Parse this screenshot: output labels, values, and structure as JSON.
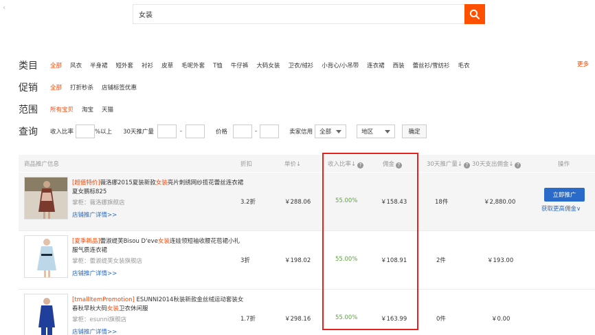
{
  "search": {
    "value": "女装"
  },
  "filters": {
    "category": {
      "label": "类目",
      "items": [
        "全部",
        "风衣",
        "半身裙",
        "短外套",
        "衬衫",
        "皮草",
        "毛呢外套",
        "T恤",
        "牛仔裤",
        "大码女装",
        "卫衣/绒衫",
        "小背心/小吊带",
        "连衣裙",
        "西装",
        "蕾丝衫/雪纺衫",
        "毛衣"
      ],
      "active_index": 0,
      "more": "更多"
    },
    "promo": {
      "label": "促销",
      "items": [
        "全部",
        "打折秒杀",
        "店铺标签优惠"
      ],
      "active_index": 0
    },
    "scope": {
      "label": "范围",
      "items": [
        "所有宝贝",
        "淘宝",
        "天猫"
      ],
      "active_index": 0
    }
  },
  "query": {
    "label": "查询",
    "income_ratio": "收入比率",
    "pct_above": "%以上",
    "promo_volume": "30天推广量",
    "dash": "-",
    "price": "价格",
    "seller_credit": "卖家信用",
    "credit_value": "全部",
    "region_value": "地区",
    "confirm": "确定"
  },
  "table": {
    "headers": {
      "info": "商品推广信息",
      "discount": "折扣",
      "price": "单价",
      "ratio": "收入比率",
      "commission": "佣金",
      "volume": "30天推广量",
      "payout": "30天支出佣金",
      "action": "操作"
    },
    "rows": [
      {
        "tag": "[超值特价]",
        "title_a": "薇洛娜2015夏装新款",
        "title_hl": "女装",
        "title_b": "亮片刺绣网纱揽花蕾丝连衣裙 夏女鹏标825",
        "shop": "掌柜：薇洛娜旗舰店",
        "detail": "店铺推广详情>>",
        "discount": "3.2折",
        "price": "￥288.06",
        "ratio": "55.00%",
        "commission": "￥158.43",
        "volume": "18件",
        "payout": "￥2,880.00",
        "action": "立即推广",
        "more": "获取更高佣金"
      },
      {
        "tag": "[夏季新品]",
        "title_a": "蕾淑缇芙Bisou D'eve",
        "title_hl": "女装",
        "title_b": "连娃领短袖收腰花苞裙小礼服气质连衣裙",
        "shop": "掌柜：蕾淑缇芙女装旗舰店",
        "detail": "店铺推广详情>>",
        "discount": "3折",
        "price": "￥198.02",
        "ratio": "55.00%",
        "commission": "￥108.91",
        "volume": "2件",
        "payout": "￥193.00"
      },
      {
        "tag": "[tmallItemPromotion]",
        "title_a": " ESUNNI2014秋装新款金丝绒运动套装女春秋早秋大码",
        "title_hl": "女装",
        "title_b": "卫衣休闲服",
        "shop": "掌柜：esunni旗舰店",
        "detail": "店铺推广详情>>",
        "discount": "1.7折",
        "price": "￥298.16",
        "ratio": "55.00%",
        "commission": "￥163.99",
        "volume": "0件",
        "payout": "￥0.00"
      }
    ]
  }
}
